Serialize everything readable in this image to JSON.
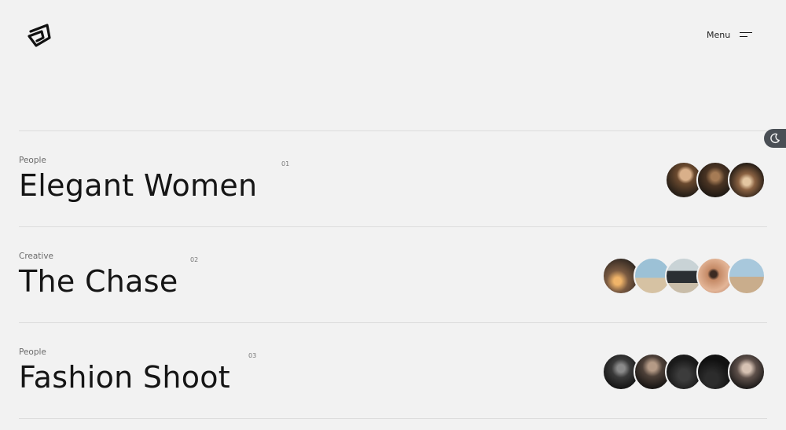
{
  "header": {
    "logo_icon": "brand-logo-icon",
    "menu_label": "Menu",
    "menu_icon": "hamburger-icon"
  },
  "theme_toggle": {
    "icon": "moon-icon"
  },
  "projects": [
    {
      "category": "People",
      "title": "Elegant Women",
      "number": "01",
      "thumbnails": [
        {
          "bg": "radial-gradient(circle at 55% 35%, #d9b08a 0 18%, #6b4a2f 30%, #2a2119 70%)"
        },
        {
          "bg": "radial-gradient(circle at 50% 40%, #a57b55 0 15%, #4a3423 35%, #1f1914 75%)"
        },
        {
          "bg": "radial-gradient(circle at 50% 55%, #e4c7a2 0 14%, #8a6242 32%, #261d16 72%)"
        }
      ]
    },
    {
      "category": "Creative",
      "title": "The Chase",
      "number": "02",
      "thumbnails": [
        {
          "bg": "radial-gradient(circle at 40% 65%, #f0b469 0 12%, #7a5a41 35%, #2c2520 80%)"
        },
        {
          "bg": "linear-gradient(180deg, #9cc1d6 0 55%, #d6c2a3 56% 100%)"
        },
        {
          "bg": "linear-gradient(180deg, #c9d3d6 0 35%, #2b2f33 36% 70%, #c9bda9 71% 100%)"
        },
        {
          "bg": "radial-gradient(circle at 45% 45%, #3b2a22 0 12%, #c58a66 22%, #e3b597 60%, #b7826a 100%)"
        },
        {
          "bg": "linear-gradient(180deg, #a8c8dc 0 52%, #c9ad8c 53% 100%)"
        }
      ]
    },
    {
      "category": "People",
      "title": "Fashion Shoot",
      "number": "03",
      "thumbnails": [
        {
          "bg": "radial-gradient(circle at 50% 40%, #8a8a8a 0 14%, #3a3a3a 34%, #151515 75%)"
        },
        {
          "bg": "radial-gradient(circle at 50% 35%, #b49a86 0 15%, #4d4038 35%, #1a1715 75%)"
        },
        {
          "bg": "radial-gradient(circle at 50% 60%, #3c3c3c 0 20%, #1a1a1a 60%)"
        },
        {
          "bg": "radial-gradient(circle at 40% 70%, #2c2c2c 0 20%, #111 60%)"
        },
        {
          "bg": "radial-gradient(circle at 50% 40%, #d6c2b3 0 16%, #5e504a 36%, #1c1a19 75%)"
        }
      ]
    }
  ]
}
